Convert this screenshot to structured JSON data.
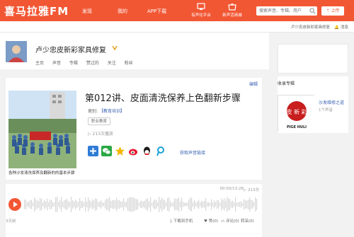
{
  "header": {
    "logo": "喜马拉雅FM",
    "nav": [
      "发现",
      "我的",
      "APP下载"
    ],
    "search_placeholder": "搜索声音、专辑、用户",
    "upload_label": "上传",
    "icons": [
      {
        "label": "有声化平台",
        "icon": "platform-icon"
      },
      {
        "label": "新声活商城",
        "icon": "shop-icon"
      }
    ]
  },
  "subbar": {
    "username": "卢少忠皮新彩家具修复",
    "messages": "消息"
  },
  "profile": {
    "name": "卢少忠皮新彩家具修复",
    "tabs": [
      "主页",
      "声音",
      "专辑",
      "赞过的",
      "关注",
      "粉丝"
    ]
  },
  "track": {
    "edit_label": "编辑",
    "title": "第012讲、皮面清洗保养上色翻新步骤",
    "category_label": "类别:",
    "category_value": "【教育培训】",
    "tag": "职业教育",
    "plays": "▷ 213次播放",
    "copy_link_label": "获取声音链接",
    "description": "各种沙发清洗保养及翻新的的基本步骤",
    "share_icons": [
      "add-share-icon",
      "wechat-icon",
      "qzone-icon",
      "weibo-icon",
      "qq-icon",
      "tencent-weibo-icon"
    ]
  },
  "player": {
    "time": "00:00/13:28",
    "plays": "▷ 213次",
    "ago": "3天前",
    "actions": [
      "下载到手机",
      "赞(0)",
      "评论(0)",
      "转采(0)"
    ]
  },
  "sidebar": {
    "album_section_title": "收录专辑",
    "album_name": "沙发维修之道",
    "album_count": "1个声音",
    "album_cover_text": "皮 新 彩",
    "album_cover_sub": "PIGE HULI"
  },
  "colors": {
    "brand": "#f25734",
    "link": "#3c64b4"
  }
}
